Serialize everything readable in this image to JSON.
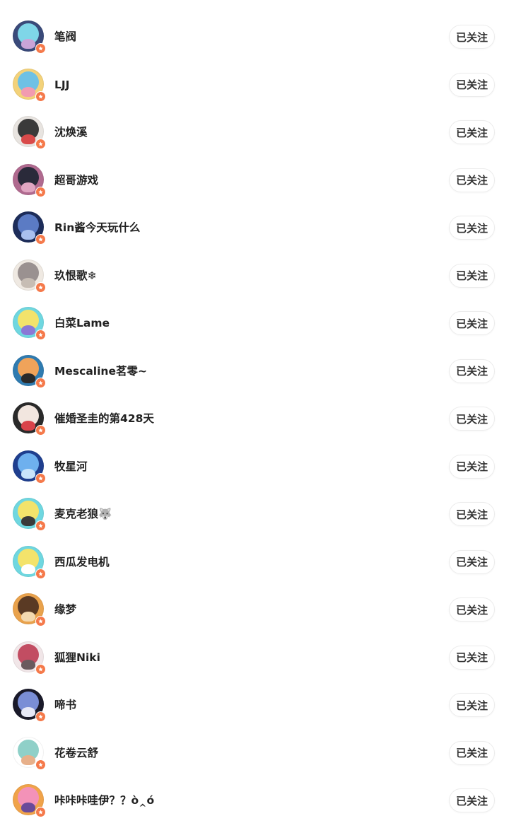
{
  "follow_list": {
    "items": [
      {
        "name": "笔阀",
        "button": "已关注",
        "colors": [
          "#3a4a7a",
          "#7fd6e8",
          "#c9a4d8"
        ]
      },
      {
        "name": "LJJ",
        "button": "已关注",
        "colors": [
          "#f3d27a",
          "#6ec1e4",
          "#f29bb0"
        ]
      },
      {
        "name": "沈焕溪",
        "button": "已关注",
        "colors": [
          "#e8e4e0",
          "#3a3a3a",
          "#d94a4a"
        ]
      },
      {
        "name": "超哥游戏",
        "button": "已关注",
        "colors": [
          "#b06a8f",
          "#2a2a3a",
          "#e0a6c2"
        ]
      },
      {
        "name": "Rin酱今天玩什么",
        "button": "已关注",
        "colors": [
          "#1d2d5a",
          "#5b7bc4",
          "#a9c0ef"
        ]
      },
      {
        "name": "玖恨歌❄",
        "button": "已关注",
        "colors": [
          "#efe9e2",
          "#9a9190",
          "#c7bdb4"
        ]
      },
      {
        "name": "白菜Lame",
        "button": "已关注",
        "colors": [
          "#6fd7e0",
          "#f3e36b",
          "#8b78d6"
        ]
      },
      {
        "name": "Mescaline茗零~",
        "button": "已关注",
        "colors": [
          "#2f7bb0",
          "#f0a35a",
          "#2a2a2a"
        ]
      },
      {
        "name": "催婚圣圭的第428天",
        "button": "已关注",
        "colors": [
          "#2a2a2a",
          "#f2e6df",
          "#d9434a"
        ]
      },
      {
        "name": "牧星河",
        "button": "已关注",
        "colors": [
          "#1f3f8f",
          "#6eb0ee",
          "#c9e4fb"
        ]
      },
      {
        "name": "麦克老狼🐺",
        "button": "已关注",
        "colors": [
          "#6fd7e0",
          "#f3e36b",
          "#3a3a3a"
        ]
      },
      {
        "name": "西瓜发电机",
        "button": "已关注",
        "colors": [
          "#6fd7e0",
          "#f3e36b",
          "#ffffff"
        ]
      },
      {
        "name": "缘梦",
        "button": "已关注",
        "colors": [
          "#e9a24c",
          "#5a3a24",
          "#f4d9b0"
        ]
      },
      {
        "name": "狐狸Niki",
        "button": "已关注",
        "colors": [
          "#f1e6e8",
          "#c24d62",
          "#6a5a5e"
        ]
      },
      {
        "name": "啼书",
        "button": "已关注",
        "colors": [
          "#1a1a2a",
          "#7a8ed6",
          "#e6e8f6"
        ]
      },
      {
        "name": "花卷云舒",
        "button": "已关注",
        "colors": [
          "#ffffff",
          "#8fd0c8",
          "#e7b08a"
        ]
      },
      {
        "name": "咔咔咔哇伊？？ò‸ó",
        "button": "已关注",
        "colors": [
          "#f0a34a",
          "#f392b8",
          "#6a4a9a"
        ]
      }
    ]
  },
  "badge_icon": "star-badge-icon",
  "badge_color": "#f5794a"
}
